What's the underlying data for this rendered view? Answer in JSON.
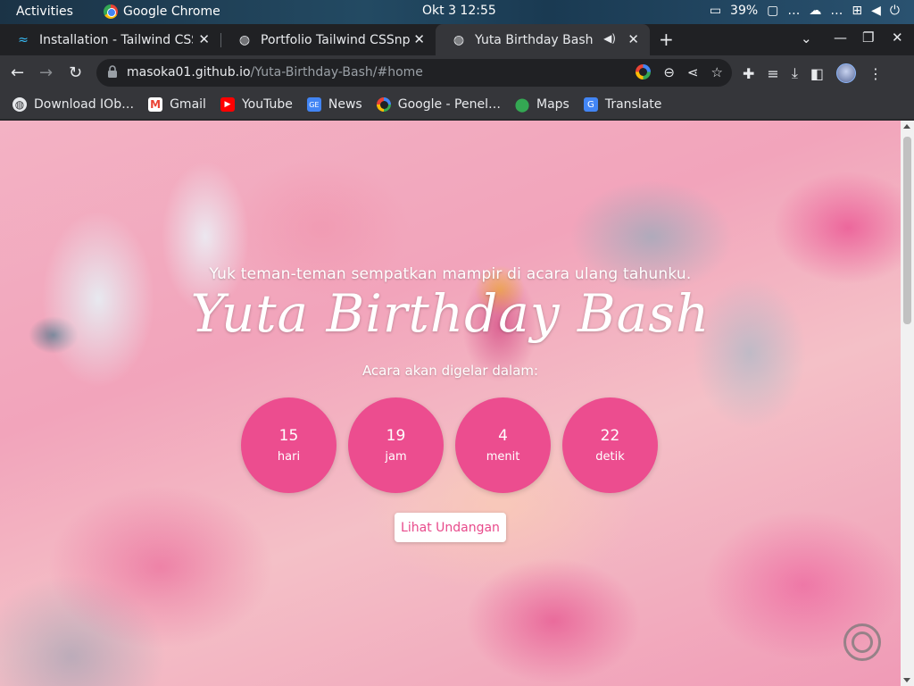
{
  "system": {
    "activities": "Activities",
    "app_name": "Google Chrome",
    "clock": "Okt 3  12:55",
    "battery": "39%",
    "tray_more_1": "…",
    "tray_more_2": "…"
  },
  "tabs": [
    {
      "title": "Installation - Tailwind CSS",
      "icon": "tailwind-icon",
      "active": false
    },
    {
      "title": "Portfolio Tailwind CSSnpm",
      "icon": "globe-icon",
      "active": false
    },
    {
      "title": "Yuta Birthday Bash",
      "icon": "globe-icon",
      "active": true
    }
  ],
  "toolbar": {
    "url_host": "masoka01.github.io",
    "url_path": "/Yuta-Birthday-Bash/#home"
  },
  "bookmarks": [
    {
      "label": "Download IOb…",
      "icon": "globe-icon"
    },
    {
      "label": "Gmail",
      "icon": "gmail-icon"
    },
    {
      "label": "YouTube",
      "icon": "youtube-icon"
    },
    {
      "label": "News",
      "icon": "news-icon"
    },
    {
      "label": "Google - Penel…",
      "icon": "google-icon"
    },
    {
      "label": "Maps",
      "icon": "maps-icon"
    },
    {
      "label": "Translate",
      "icon": "translate-icon"
    }
  ],
  "page": {
    "subtitle": "Yuk teman-teman sempatkan mampir di acara ulang tahunku.",
    "headline": "Yuta Birthday Bash",
    "caption": "Acara akan digelar dalam:",
    "countdown": [
      {
        "value": "15",
        "unit": "hari"
      },
      {
        "value": "19",
        "unit": "jam"
      },
      {
        "value": "4",
        "unit": "menit"
      },
      {
        "value": "22",
        "unit": "detik"
      }
    ],
    "cta_label": "Lihat Undangan",
    "accent_color": "#ec4d8f"
  }
}
